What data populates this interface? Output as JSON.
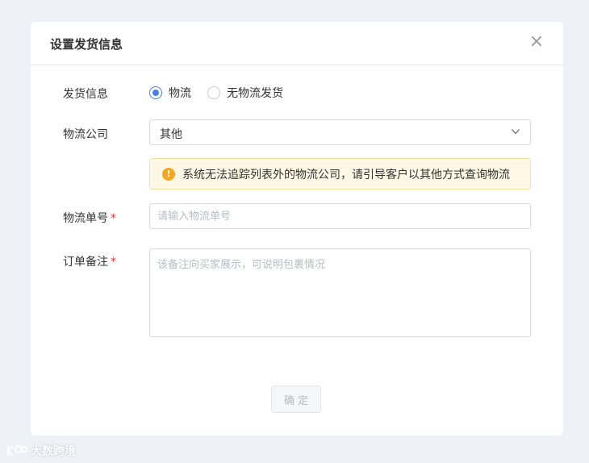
{
  "dialog": {
    "title": "设置发货信息",
    "close_glyph": "×"
  },
  "form": {
    "shipping": {
      "label": "发货信息",
      "options": [
        {
          "label": "物流",
          "checked": true
        },
        {
          "label": "无物流发货",
          "checked": false
        }
      ]
    },
    "company": {
      "label": "物流公司",
      "selected": "其他"
    },
    "notice": {
      "icon_glyph": "!",
      "text": "系统无法追踪列表外的物流公司，请引导客户以其他方式查询物流"
    },
    "tracking": {
      "label": "物流单号",
      "required_mark": "*",
      "value": "",
      "placeholder": "请输入物流单号"
    },
    "remark": {
      "label": "订单备注",
      "required_mark": "*",
      "value": "",
      "placeholder": "该备注向买家展示，可说明包裹情况"
    }
  },
  "footer": {
    "confirm_label": "确定"
  },
  "watermark": {
    "text": "大数跨境"
  },
  "colors": {
    "accent": "#4a7ee8",
    "warning": "#f5a623",
    "required": "#e0443b",
    "background": "#eef1f6"
  },
  "icons": {
    "close": "close-icon",
    "select": "chevron-down-icon",
    "notice": "warning-icon",
    "watermark": "brand-logo-icon"
  }
}
